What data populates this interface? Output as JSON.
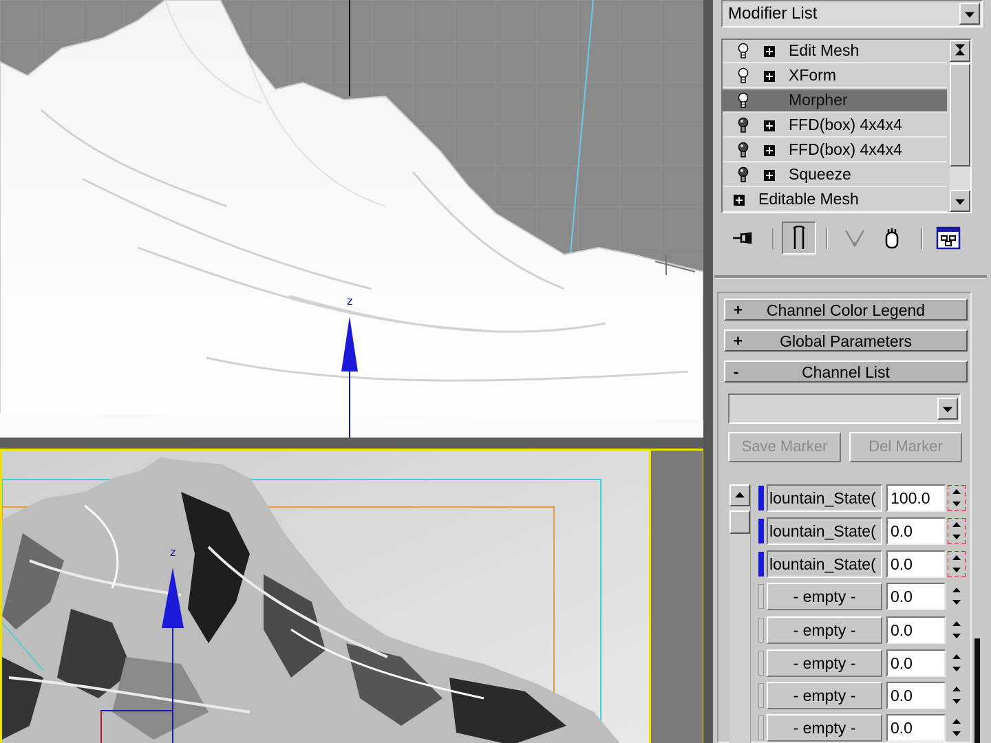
{
  "modifier_list": {
    "label": "Modifier List"
  },
  "stack": {
    "items": [
      {
        "label": "Edit Mesh",
        "selected": false,
        "has_bulb": true,
        "expandable": true
      },
      {
        "label": "XForm",
        "selected": false,
        "has_bulb": true,
        "expandable": true
      },
      {
        "label": "Morpher",
        "selected": true,
        "has_bulb": true,
        "expandable": false
      },
      {
        "label": "FFD(box) 4x4x4",
        "selected": false,
        "has_bulb": true,
        "expandable": true
      },
      {
        "label": "FFD(box) 4x4x4",
        "selected": false,
        "has_bulb": true,
        "expandable": true
      },
      {
        "label": "Squeeze",
        "selected": false,
        "has_bulb": true,
        "expandable": true
      },
      {
        "label": "Editable Mesh",
        "selected": false,
        "has_bulb": false,
        "expandable": true
      }
    ]
  },
  "toolbar_icons": [
    "pin-stack-icon",
    "show-end-result-icon",
    "make-unique-icon",
    "remove-modifier-icon",
    "configure-modifier-sets-icon"
  ],
  "rollouts": {
    "channel_color_legend": {
      "sign": "+",
      "title": "Channel Color Legend"
    },
    "global_parameters": {
      "sign": "+",
      "title": "Global Parameters"
    },
    "channel_list": {
      "sign": "-",
      "title": "Channel List"
    }
  },
  "channel_list": {
    "select_value": "",
    "save_marker": "Save Marker",
    "del_marker": "Del Marker",
    "channels": [
      {
        "name": "lountain_State(",
        "value": "100.0",
        "color_on": true,
        "keyed": true
      },
      {
        "name": "lountain_State(",
        "value": "0.0",
        "color_on": true,
        "keyed": true
      },
      {
        "name": "lountain_State(",
        "value": "0.0",
        "color_on": true,
        "keyed": true
      },
      {
        "name": "- empty -",
        "value": "0.0",
        "color_on": false,
        "keyed": false
      },
      {
        "name": "- empty -",
        "value": "0.0",
        "color_on": false,
        "keyed": false
      },
      {
        "name": "- empty -",
        "value": "0.0",
        "color_on": false,
        "keyed": false
      },
      {
        "name": "- empty -",
        "value": "0.0",
        "color_on": false,
        "keyed": false
      },
      {
        "name": "- empty -",
        "value": "0.0",
        "color_on": false,
        "keyed": false
      }
    ]
  },
  "viewports": {
    "top_gizmo_axis": "z",
    "bottom_gizmo_axis": "z",
    "active_border_color": "#f0e000",
    "gizmo_color": "#1a1ad8",
    "safe_frame_color": "#40d0d0",
    "region_frame_color": "#e0a040"
  }
}
